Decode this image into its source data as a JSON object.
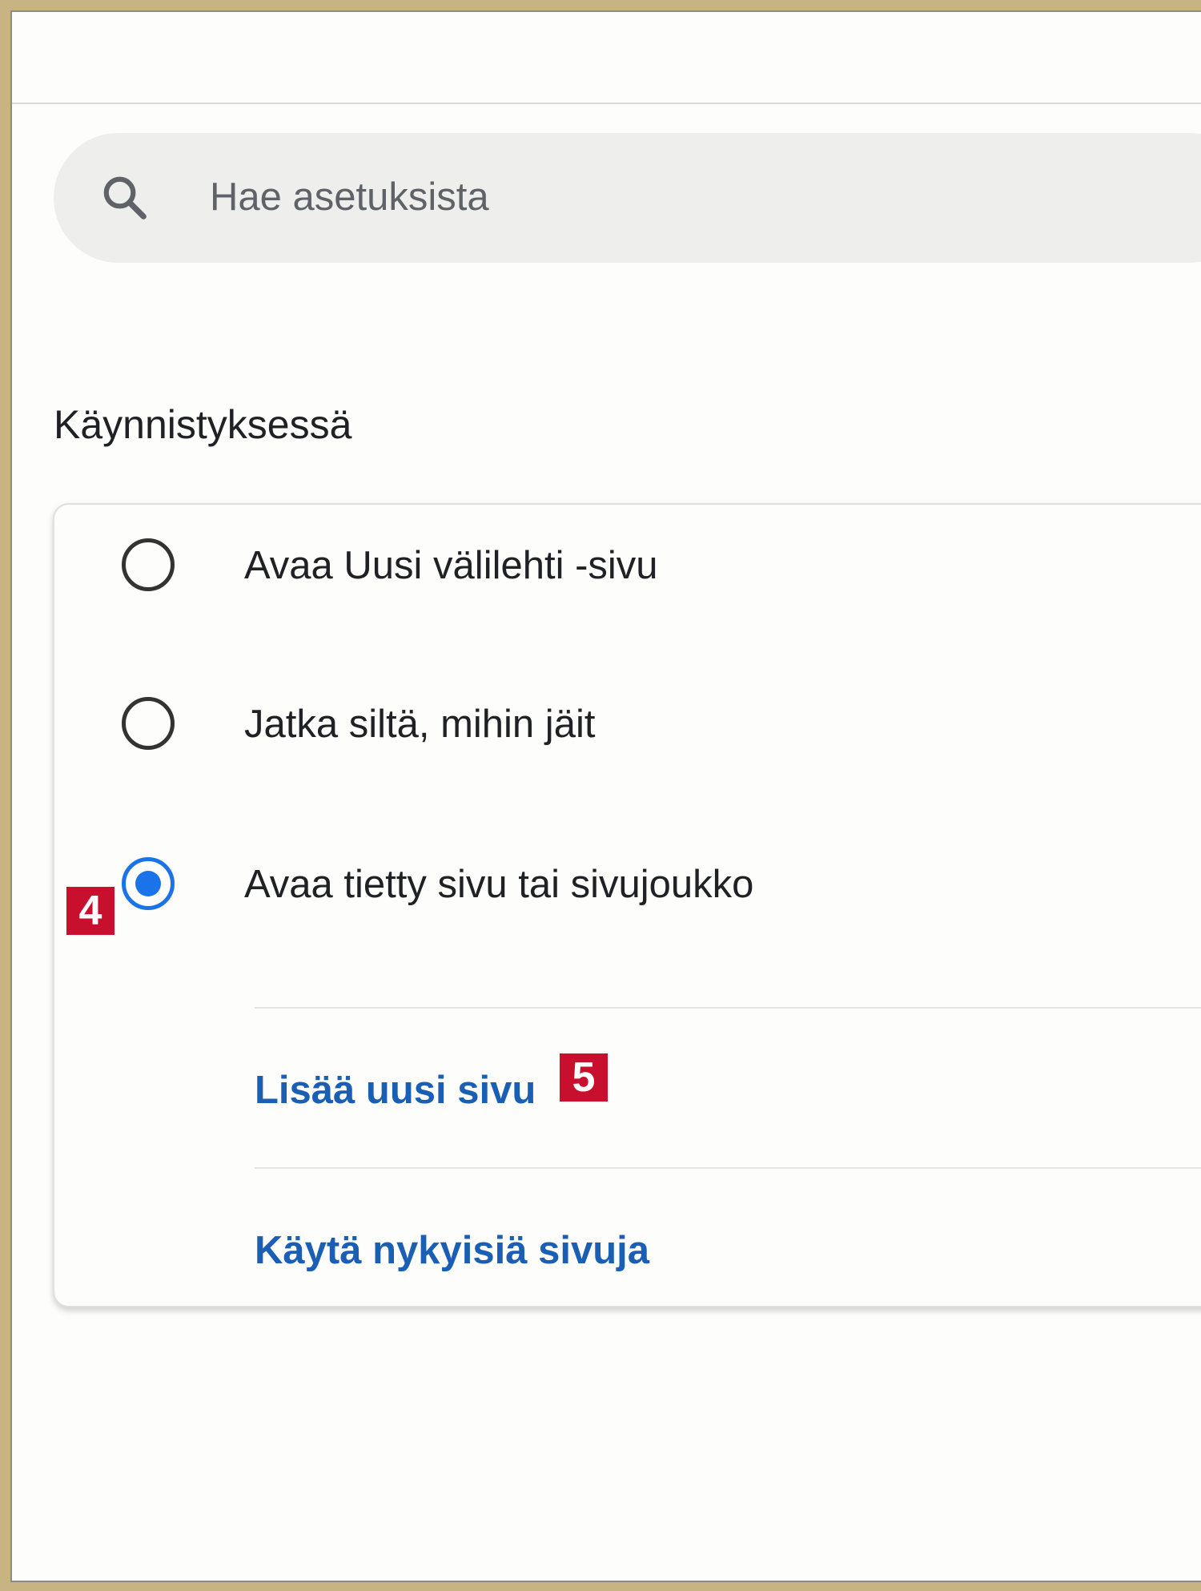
{
  "search": {
    "placeholder": "Hae asetuksista",
    "icon": "search-icon"
  },
  "startup": {
    "title": "Käynnistyksessä",
    "options": [
      {
        "label": "Avaa Uusi välilehti -sivu",
        "checked": false
      },
      {
        "label": "Jatka siltä, mihin jäit",
        "checked": false
      },
      {
        "label": "Avaa tietty sivu tai sivujoukko",
        "checked": true
      }
    ],
    "add_page_label": "Lisää uusi sivu",
    "use_current_label": "Käytä nykyisiä sivuja"
  },
  "callouts": {
    "step4": "4",
    "step5": "5"
  },
  "colors": {
    "accent": "#1a73e8",
    "link": "#1a5fb4",
    "callout": "#c8102e",
    "frame": "#c6b483"
  }
}
